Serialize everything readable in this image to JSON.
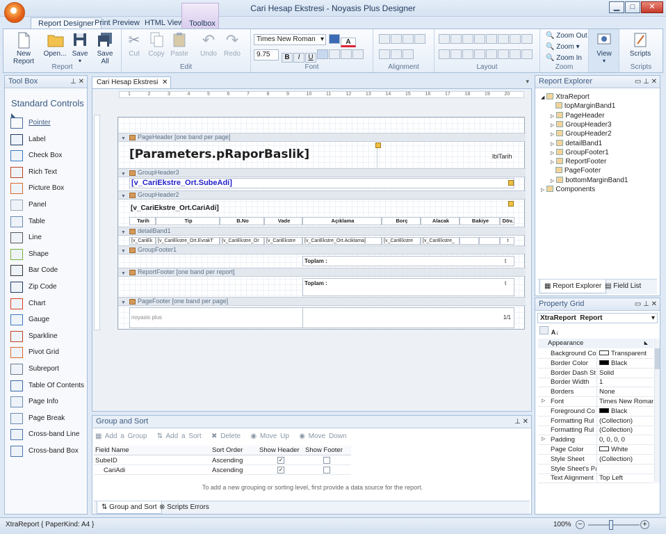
{
  "window": {
    "title": "Cari Hesap Ekstresi - Noyasis Plus Designer"
  },
  "tabs": [
    "Report Designer",
    "Print Preview",
    "HTML View",
    "Toolbox"
  ],
  "ribbon": {
    "report": {
      "label": "Report",
      "new": "New Report",
      "open": "Open...",
      "save": "Save",
      "save_all": "Save All"
    },
    "edit": {
      "label": "Edit",
      "cut": "Cut",
      "copy": "Copy",
      "paste": "Paste",
      "undo": "Undo",
      "redo": "Redo"
    },
    "font": {
      "label": "Font",
      "name": "Times New Roman",
      "size": "9.75",
      "bold": "B",
      "italic": "I",
      "underline": "U"
    },
    "alignment": {
      "label": "Alignment"
    },
    "layout": {
      "label": "Layout"
    },
    "zoom": {
      "label": "Zoom",
      "zoom_out": "Zoom Out",
      "zoom": "Zoom",
      "zoom_in": "Zoom In"
    },
    "view": {
      "label": "View"
    },
    "scripts": {
      "label": "Scripts",
      "button": "Scripts"
    }
  },
  "toolbox": {
    "title": "Tool Box",
    "section": "Standard Controls",
    "items": [
      "Pointer",
      "Label",
      "Check Box",
      "Rich Text",
      "Picture Box",
      "Panel",
      "Table",
      "Line",
      "Shape",
      "Bar Code",
      "Zip Code",
      "Chart",
      "Gauge",
      "Sparkline",
      "Pivot Grid",
      "Subreport",
      "Table Of Contents",
      "Page Info",
      "Page Break",
      "Cross-band Line",
      "Cross-band Box"
    ]
  },
  "designer": {
    "doc_tab": "Cari Hesap Ekstresi",
    "ruler": [
      "1",
      "2",
      "3",
      "4",
      "5",
      "6",
      "7",
      "8",
      "9",
      "10",
      "11",
      "12",
      "13",
      "14",
      "15",
      "16",
      "17",
      "18",
      "19",
      "20"
    ],
    "bands": {
      "page_header": "PageHeader [one band per page]",
      "group_header3": "GroupHeader3",
      "group_header2": "GroupHeader2",
      "detail": "detailBand1",
      "group_footer": "GroupFooter1",
      "report_footer": "ReportFooter [one band per report]",
      "page_footer": "PageFooter [one band per page]"
    },
    "title_param": "[Parameters.pRaporBaslik]",
    "date_label": "lblTarih",
    "sube": "[v_CariEkstre_Ort.SubeAdi]",
    "cari": "[v_CariEkstre_Ort.CariAdi]",
    "columns": [
      "Tarih",
      "Tip",
      "B.No",
      "Vade",
      "Açıklama",
      "Borç",
      "Alacak",
      "Bakiye",
      "Döv."
    ],
    "detail_cells": [
      "[v_CariEk",
      "[v_CariEkstre_Ort.EvrakT",
      "[v_CariEkstre_Or",
      "[v_CariEkstre",
      "[v_CariEkstre_Ort.Aciklama]",
      "[v_CariEkstre",
      "[v_CariEkstre_",
      "",
      "",
      "t"
    ],
    "total_label": "Toplam :",
    "currency": "t",
    "footer_left": "noyasis plus",
    "footer_right": "1/1"
  },
  "group_sort": {
    "title": "Group and Sort",
    "toolbar": {
      "add_group": "Add a Group",
      "add_sort": "Add a Sort",
      "delete": "Delete",
      "move_up": "Move Up",
      "move_down": "Move Down"
    },
    "headers": [
      "Field Name",
      "Sort Order",
      "Show Header",
      "Show Footer"
    ],
    "rows": [
      {
        "field": "SubeID",
        "order": "Ascending"
      },
      {
        "field": "CariAdi",
        "order": "Ascending"
      }
    ],
    "hint": "To add a new grouping or sorting level, first provide a data source for the report.",
    "tabs": [
      "Group and Sort",
      "Scripts Errors"
    ]
  },
  "report_explorer": {
    "title": "Report Explorer",
    "items": [
      "XtraReport",
      "topMarginBand1",
      "PageHeader",
      "GroupHeader3",
      "GroupHeader2",
      "detailBand1",
      "GroupFooter1",
      "ReportFooter",
      "PageFooter",
      "bottomMarginBand1",
      "Components"
    ],
    "tabs": [
      "Report Explorer",
      "Field List"
    ]
  },
  "property_grid": {
    "title": "Property Grid",
    "object": "XtraReport",
    "object_type": "Report",
    "category": "Appearance",
    "props": [
      [
        "Background Co",
        "Transparent"
      ],
      [
        "Border Color",
        "Black"
      ],
      [
        "Border Dash St",
        "Solid"
      ],
      [
        "Border Width",
        "1"
      ],
      [
        "Borders",
        "None"
      ],
      [
        "Font",
        "Times New Roman..."
      ],
      [
        "Foreground Co",
        "Black"
      ],
      [
        "Formatting Rul",
        "(Collection)"
      ],
      [
        "Formatting Rul",
        "(Collection)"
      ],
      [
        "Padding",
        "0, 0, 0, 0"
      ],
      [
        "Page Color",
        "White"
      ],
      [
        "Style Sheet",
        "(Collection)"
      ],
      [
        "Style Sheet's Pa",
        ""
      ],
      [
        "Text Alignment",
        "Top Left"
      ]
    ]
  },
  "status": {
    "left": "XtraReport { PaperKind: A4 }",
    "zoom": "100%"
  }
}
